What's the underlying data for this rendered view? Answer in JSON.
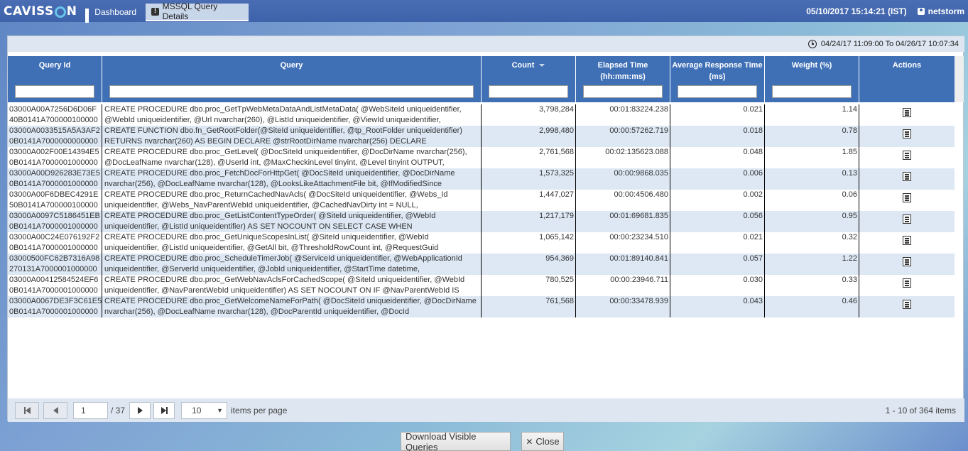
{
  "app": {
    "logo": "CAVISSON"
  },
  "tabs": [
    {
      "label": "Dashboard"
    },
    {
      "label": "MSSQL Query Details"
    }
  ],
  "header": {
    "datetime": "05/10/2017 15:14:21 (IST)",
    "user": "netstorm"
  },
  "timerange": "04/24/17 11:09:00 To 04/26/17 10:07:34",
  "columns": {
    "query_id": "Query Id",
    "query": "Query",
    "count": "Count",
    "elapsed_1": "Elapsed Time",
    "elapsed_2": "(hh:mm:ms)",
    "avg_1": "Average Response Time",
    "avg_2": "(ms)",
    "weight": "Weight (%)",
    "actions": "Actions"
  },
  "rows": [
    {
      "id1": "03000A00A7256D6D06F",
      "id2": "40B0141A700000100000",
      "q1": "CREATE PROCEDURE dbo.proc_GetTpWebMetaDataAndListMetaData( @WebSiteId uniqueidentifier,",
      "q2": "@WebId uniqueidentifier, @Url nvarchar(260), @ListId uniqueidentifier, @ViewId uniqueidentifier,",
      "count": "3,798,284",
      "elapsed": "00:01:83224.238",
      "avg": "0.021",
      "weight": "1.14"
    },
    {
      "id1": "03000A0033515A5A3AF2",
      "id2": "0B0141A7000000000000",
      "q1": "CREATE FUNCTION dbo.fn_GetRootFolder(@SiteId uniqueidentifier, @tp_RootFolder uniqueidentifier)",
      "q2": "RETURNS nvarchar(260) AS BEGIN DECLARE @strRootDirName nvarchar(256) DECLARE",
      "count": "2,998,480",
      "elapsed": "00:00:57262.719",
      "avg": "0.018",
      "weight": "0.78"
    },
    {
      "id1": "03000A002F00E14394E5",
      "id2": "0B0141A7000001000000",
      "q1": "CREATE PROCEDURE dbo.proc_GetLevel( @DocSiteId uniqueidentifier, @DocDirName nvarchar(256),",
      "q2": "@DocLeafName nvarchar(128), @UserId int, @MaxCheckinLevel tinyint, @Level tinyint OUTPUT,",
      "count": "2,761,568",
      "elapsed": "00:02:135623.088",
      "avg": "0.048",
      "weight": "1.85"
    },
    {
      "id1": "03000A00D926283E73E5",
      "id2": "0B0141A7000001000000",
      "q1": "CREATE PROCEDURE dbo.proc_FetchDocForHttpGet( @DocSiteId uniqueidentifier, @DocDirName",
      "q2": "nvarchar(256), @DocLeafName nvarchar(128), @LooksLikeAttachmentFile bit, @IfModifiedSince",
      "count": "1,573,325",
      "elapsed": "00:00:9868.035",
      "avg": "0.006",
      "weight": "0.13"
    },
    {
      "id1": "03000A00F6DBEC4291E",
      "id2": "50B0141A700000100000",
      "q1": "CREATE PROCEDURE dbo.proc_ReturnCachedNavAcls( @DocSiteId uniqueidentifier, @Webs_Id",
      "q2": "uniqueidentifier, @Webs_NavParentWebId uniqueidentifier, @CachedNavDirty int = NULL,",
      "count": "1,447,027",
      "elapsed": "00:00:4506.480",
      "avg": "0.002",
      "weight": "0.06"
    },
    {
      "id1": "03000A0097C5186451EB",
      "id2": "0B0141A7000001000000",
      "q1": "CREATE PROCEDURE dbo.proc_GetListContentTypeOrder( @SiteId uniqueidentifier, @WebId",
      "q2": "uniqueidentifier, @ListId uniqueidentifier) AS SET NOCOUNT ON SELECT CASE WHEN",
      "count": "1,217,179",
      "elapsed": "00:01:69681.835",
      "avg": "0.056",
      "weight": "0.95"
    },
    {
      "id1": "03000A00C24E076192F2",
      "id2": "0B0141A7000001000000",
      "q1": "CREATE PROCEDURE dbo.proc_GetUniqueScopesInList( @SiteId uniqueidentifier, @WebId",
      "q2": "uniqueidentifier, @ListId uniqueidentifier, @GetAll bit, @ThresholdRowCount int, @RequestGuid",
      "count": "1,065,142",
      "elapsed": "00:00:23234.510",
      "avg": "0.021",
      "weight": "0.32"
    },
    {
      "id1": "03000500FC62B7316A98",
      "id2": "270131A7000001000000",
      "q1": "CREATE PROCEDURE dbo.proc_ScheduleTimerJob( @ServiceId uniqueidentifier,  @WebApplicationId",
      "q2": "uniqueidentifier, @ServerId uniqueidentifier, @JobId uniqueidentifier, @StartTime datetime,",
      "count": "954,369",
      "elapsed": "00:01:89140.841",
      "avg": "0.057",
      "weight": "1.22"
    },
    {
      "id1": "03000A00412584524EF6",
      "id2": "0B0141A7000001000000",
      "q1": "CREATE PROCEDURE dbo.proc_GetWebNavAclsForCachedScope( @SiteId uniqueidentifier, @WebId",
      "q2": "uniqueidentifier, @NavParentWebId uniqueidentifier) AS SET NOCOUNT ON IF @NavParentWebId IS",
      "count": "780,525",
      "elapsed": "00:00:23946.711",
      "avg": "0.030",
      "weight": "0.33"
    },
    {
      "id1": "03000A0067DE3F3C61E5",
      "id2": "0B0141A7000001000000",
      "q1": "CREATE PROCEDURE dbo.proc_GetWelcomeNameForPath( @DocSiteId uniqueidentifier, @DocDirName",
      "q2": "nvarchar(256), @DocLeafName nvarchar(128), @DocParentId uniqueidentifier, @DocId",
      "count": "761,568",
      "elapsed": "00:00:33478.939",
      "avg": "0.043",
      "weight": "0.46"
    }
  ],
  "pager": {
    "page": "1",
    "total": "/ 37",
    "page_size": "10",
    "per_page_label": "items per page",
    "info": "1 - 10 of 364 items"
  },
  "buttons": {
    "download": "Download Visible Queries",
    "close": "Close"
  }
}
